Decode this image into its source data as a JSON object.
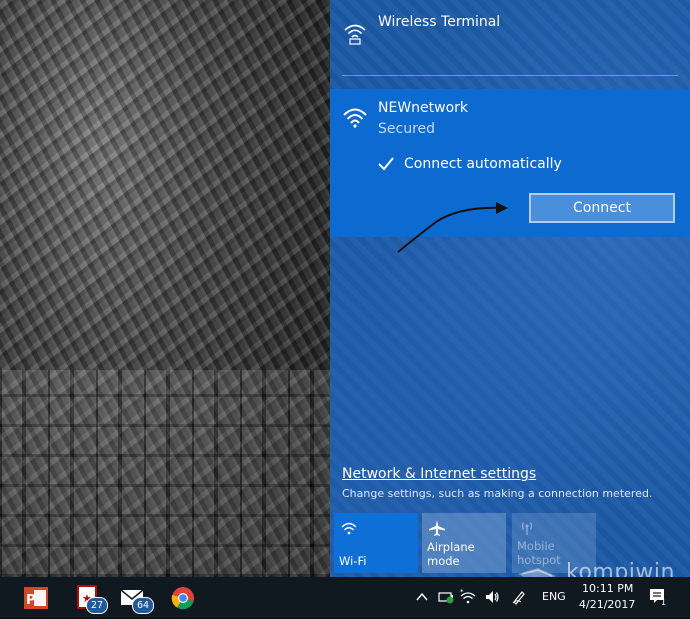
{
  "networks": {
    "other": {
      "name": "Wireless Terminal"
    },
    "selected": {
      "name": "NEWnetwork",
      "status": "Secured",
      "auto_connect_label": "Connect automatically",
      "auto_connect_checked": true,
      "connect_label": "Connect"
    }
  },
  "settings": {
    "link": "Network & Internet settings",
    "description": "Change settings, such as making a connection metered."
  },
  "quick_actions": [
    {
      "label": "Wi-Fi",
      "icon": "wifi-icon",
      "active": true
    },
    {
      "label": "Airplane mode",
      "icon": "airplane-icon",
      "active": false
    },
    {
      "label": "Mobile hotspot",
      "icon": "hotspot-icon",
      "active": false,
      "disabled": true
    }
  ],
  "watermark": {
    "text": "kompiwin"
  },
  "taskbar": {
    "apps": [
      {
        "name": "PowerPoint",
        "icon": "powerpoint-icon"
      },
      {
        "name": "Adobe Reader",
        "icon": "pdf-icon",
        "badge": "27"
      },
      {
        "name": "Mail",
        "icon": "mail-icon",
        "badge": "64"
      },
      {
        "name": "Chrome",
        "icon": "chrome-icon"
      }
    ],
    "tray": {
      "language": "ENG",
      "time": "10:11 PM",
      "date": "4/21/2017",
      "action_center_count": "1"
    }
  },
  "colors": {
    "flyout_bg": "#1c5aa6",
    "selected_bg": "#0d6ad1",
    "wifi_tile_active": "#0e6fd6",
    "taskbar_bg": "#101820",
    "badge_bg": "#1f5a9e"
  }
}
